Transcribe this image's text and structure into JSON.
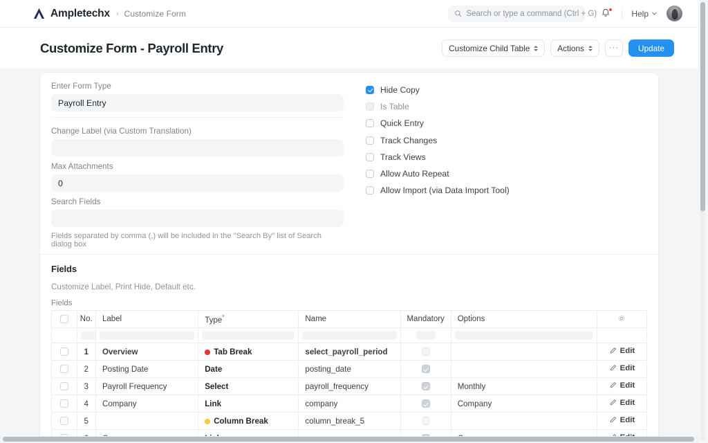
{
  "navbar": {
    "brand": "Ampletechx",
    "breadcrumb_separator": "›",
    "breadcrumb": "Customize Form",
    "search_placeholder": "Search or type a command (Ctrl + G)",
    "help_label": "Help"
  },
  "page_header": {
    "title": "Customize Form - Payroll Entry",
    "customize_child_table": "Customize Child Table",
    "actions": "Actions",
    "more": "···",
    "update": "Update"
  },
  "form": {
    "enter_form_type": {
      "label": "Enter Form Type",
      "value": "Payroll Entry"
    },
    "change_label": {
      "label": "Change Label (via Custom Translation)",
      "value": ""
    },
    "max_attachments": {
      "label": "Max Attachments",
      "value": "0"
    },
    "search_fields": {
      "label": "Search Fields",
      "value": "",
      "description": "Fields separated by comma (,) will be included in the \"Search By\" list of Search dialog box"
    },
    "checkboxes": [
      {
        "label": "Hide Copy",
        "checked": true,
        "disabled": false
      },
      {
        "label": "Is Table",
        "checked": false,
        "disabled": true
      },
      {
        "label": "Quick Entry",
        "checked": false,
        "disabled": false
      },
      {
        "label": "Track Changes",
        "checked": false,
        "disabled": false
      },
      {
        "label": "Track Views",
        "checked": false,
        "disabled": false
      },
      {
        "label": "Allow Auto Repeat",
        "checked": false,
        "disabled": false
      },
      {
        "label": "Allow Import (via Data Import Tool)",
        "checked": false,
        "disabled": false
      }
    ]
  },
  "fields_section": {
    "title": "Fields",
    "subtitle": "Customize Label, Print Hide, Default etc.",
    "grid_label": "Fields",
    "columns": {
      "no": "No.",
      "label": "Label",
      "type": "Type",
      "type_required_marker": "*",
      "name": "Name",
      "mandatory": "Mandatory",
      "options": "Options",
      "settings_icon": "gear-icon"
    },
    "edit_label": "Edit",
    "rows": [
      {
        "no": "1",
        "label": "Overview",
        "type": "Tab Break",
        "type_dot": "#e8392e",
        "name": "select_payroll_period",
        "mandatory": "off",
        "options": "",
        "bold": true
      },
      {
        "no": "2",
        "label": "Posting Date",
        "type": "Date",
        "type_dot": "",
        "name": "posting_date",
        "mandatory": "on",
        "options": "",
        "bold": false
      },
      {
        "no": "3",
        "label": "Payroll Frequency",
        "type": "Select",
        "type_dot": "",
        "name": "payroll_frequency",
        "mandatory": "on",
        "options": "Monthly",
        "bold": false
      },
      {
        "no": "4",
        "label": "Company",
        "type": "Link",
        "type_dot": "",
        "name": "company",
        "mandatory": "on",
        "options": "Company",
        "bold": false
      },
      {
        "no": "5",
        "label": "",
        "type": "Column Break",
        "type_dot": "#f5cb3d",
        "name": "column_break_5",
        "mandatory": "off",
        "options": "",
        "bold": false
      },
      {
        "no": "6",
        "label": "Currency",
        "type": "Link",
        "type_dot": "",
        "name": "currency",
        "mandatory": "on",
        "options": "Currency",
        "bold": false
      }
    ]
  },
  "colors": {
    "primary": "#2490ef",
    "danger": "#e8392e",
    "warning": "#f5cb3d",
    "page_bg": "#f4f5f6"
  }
}
